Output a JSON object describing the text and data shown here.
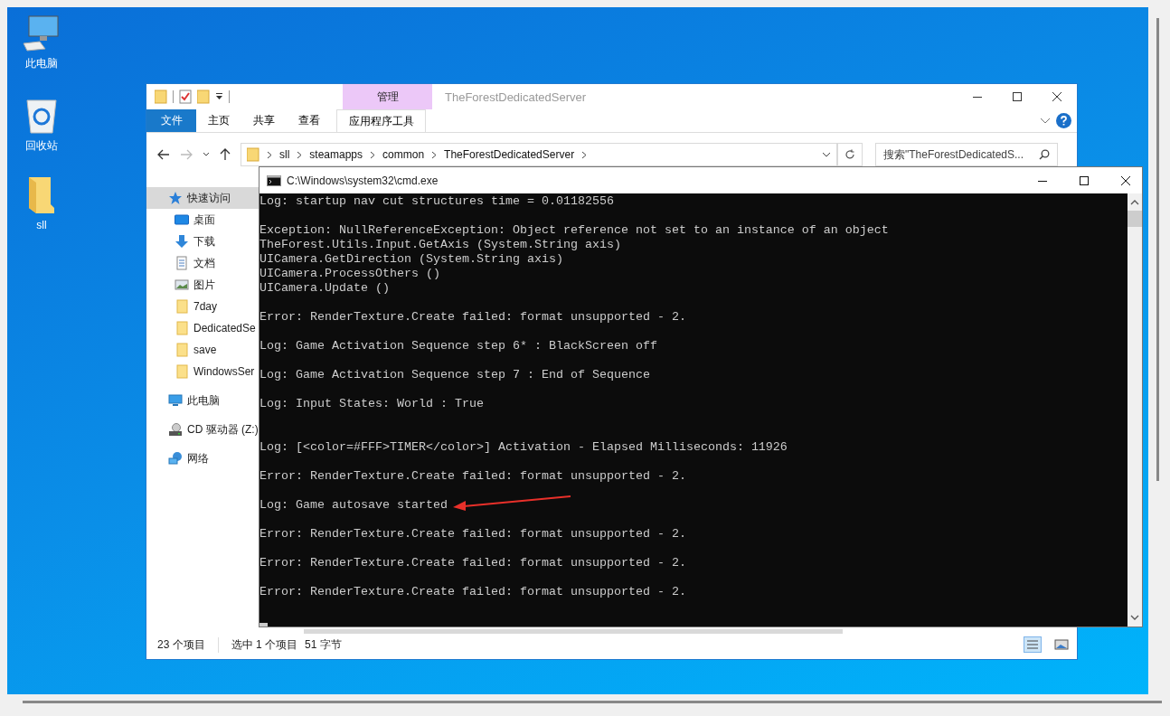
{
  "desktop": {
    "icons": [
      {
        "label": "此电脑",
        "kind": "computer"
      },
      {
        "label": "回收站",
        "kind": "recycle"
      },
      {
        "label": "sll",
        "kind": "folder"
      }
    ]
  },
  "explorer": {
    "title": "TheForestDedicatedServer",
    "context_group": "管理",
    "file_tab": "文件",
    "tabs": [
      {
        "label": "主页",
        "kind": "plain"
      },
      {
        "label": "共享",
        "kind": "plain"
      },
      {
        "label": "查看",
        "kind": "plain"
      },
      {
        "label": "应用程序工具",
        "kind": "context"
      }
    ],
    "crumbs": [
      "sll",
      "steamapps",
      "common",
      "TheForestDedicatedServer"
    ],
    "search": {
      "placeholder": "搜索\"TheForestDedicatedS..."
    },
    "nav": [
      {
        "label": "快速访问",
        "kind": "star",
        "selected": true,
        "children": [
          {
            "label": "桌面",
            "kind": "desktop",
            "selected": false
          },
          {
            "label": "下载",
            "kind": "download",
            "selected": false
          },
          {
            "label": "文档",
            "kind": "document",
            "selected": false
          },
          {
            "label": "图片",
            "kind": "picture",
            "selected": false
          },
          {
            "label": "7day",
            "kind": "folder",
            "selected": false
          },
          {
            "label": "DedicatedSe",
            "kind": "folder",
            "selected": false
          },
          {
            "label": "save",
            "kind": "folder",
            "selected": false
          },
          {
            "label": "WindowsSer",
            "kind": "folder",
            "selected": false
          }
        ]
      },
      {
        "label": "此电脑",
        "kind": "computer",
        "selected": false
      },
      {
        "label": "CD 驱动器 (Z:)",
        "kind": "drive",
        "selected": false
      },
      {
        "label": "网络",
        "kind": "network",
        "selected": false
      }
    ],
    "status": [
      "23 个项目",
      "选中 1 个项目",
      "51 字节"
    ]
  },
  "cmd": {
    "title": "C:\\Windows\\system32\\cmd.exe",
    "blocks": [
      {
        "extra_gap": false,
        "lines": [
          "Log: startup nav cut structures time = 0.01182556"
        ]
      },
      {
        "extra_gap": false,
        "lines": [
          "Exception: NullReferenceException: Object reference not set to an instance of an object",
          "TheForest.Utils.Input.GetAxis (System.String axis)",
          "UICamera.GetDirection (System.String axis)",
          "UICamera.ProcessOthers ()",
          "UICamera.Update ()"
        ]
      },
      {
        "extra_gap": false,
        "lines": [
          "Error: RenderTexture.Create failed: format unsupported - 2."
        ]
      },
      {
        "extra_gap": false,
        "lines": [
          "Log: Game Activation Sequence step 6* : BlackScreen off"
        ]
      },
      {
        "extra_gap": false,
        "lines": [
          "Log: Game Activation Sequence step 7 : End of Sequence"
        ]
      },
      {
        "extra_gap": false,
        "lines": [
          "Log: Input States: World : True"
        ]
      },
      {
        "extra_gap": true,
        "lines": [
          "Log: [<color=#FFF>TIMER</color>] Activation - Elapsed Milliseconds: 11926"
        ]
      },
      {
        "extra_gap": false,
        "lines": [
          "Error: RenderTexture.Create failed: format unsupported - 2."
        ]
      },
      {
        "extra_gap": false,
        "lines": [
          "Log: Game autosave started"
        ]
      },
      {
        "extra_gap": false,
        "lines": [
          "Error: RenderTexture.Create failed: format unsupported - 2."
        ]
      },
      {
        "extra_gap": false,
        "lines": [
          "Error: RenderTexture.Create failed: format unsupported - 2."
        ]
      },
      {
        "extra_gap": false,
        "lines": [
          "Error: RenderTexture.Create failed: format unsupported - 2."
        ]
      }
    ]
  }
}
